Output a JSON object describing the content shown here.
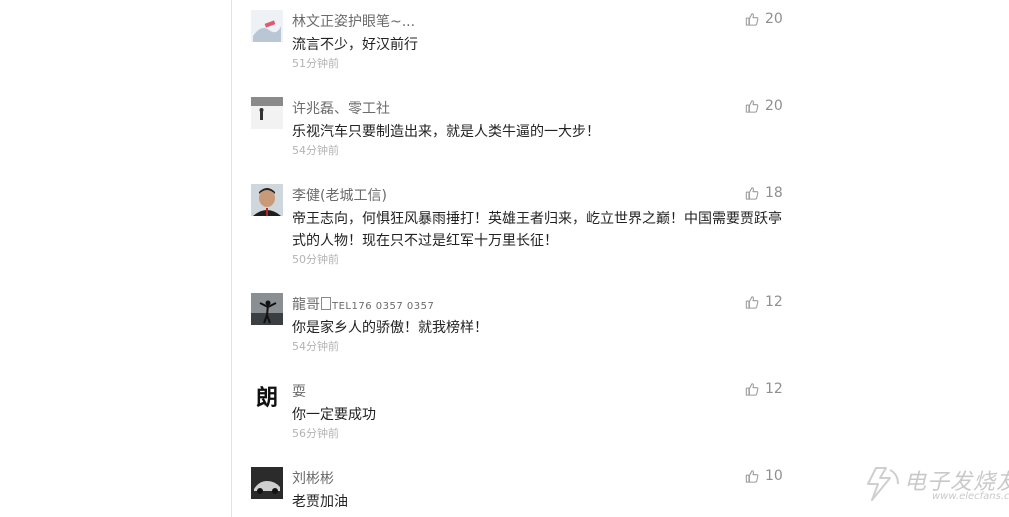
{
  "comments": [
    {
      "name": "林文正姿护眼笔~...",
      "text": "流言不少，好汉前行",
      "time": "51分钟前",
      "likes": "20"
    },
    {
      "name": "许兆磊、零工社",
      "text": "乐视汽车只要制造出来，就是人类牛逼的一大步！",
      "time": "54分钟前",
      "likes": "20"
    },
    {
      "name": "李健(老城工信)",
      "text": "帝王志向，何惧狂风暴雨捶打！英雄王者归来，屹立世界之巅！中国需要贾跃亭式的人物！现在只不过是红军十万里长征！",
      "time": "50分钟前",
      "likes": "18"
    },
    {
      "name": "龍哥",
      "name_tel": "TEL176 0357 0357",
      "text": "你是家乡人的骄傲！就我榜样！",
      "time": "54分钟前",
      "likes": "12"
    },
    {
      "name": "耍",
      "avatar_char": "朗",
      "text": "你一定要成功",
      "time": "56分钟前",
      "likes": "12"
    },
    {
      "name": "刘彬彬",
      "text": "老贾加油",
      "time": "",
      "likes": "10"
    }
  ],
  "watermark": {
    "title": "电子发烧友",
    "sub": "www.elecfans.com"
  },
  "colors": {
    "name": "#6b6b6b",
    "text": "#222222",
    "time": "#b3b3b3",
    "like": "#8f8f8f"
  },
  "icons": {
    "like": "thumbs-up-icon"
  }
}
